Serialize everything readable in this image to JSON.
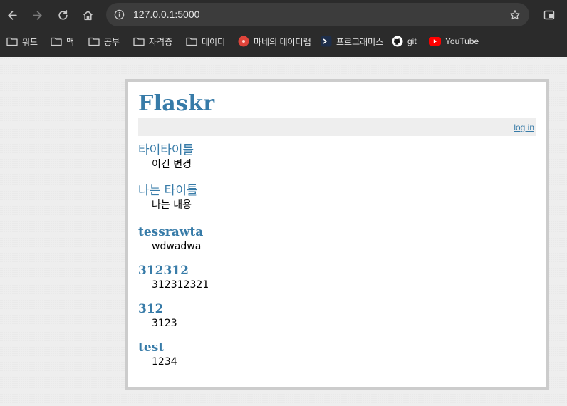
{
  "browser": {
    "url": "127.0.0.1:5000",
    "bookmarks": [
      {
        "label": "워드",
        "icon": "folder-icon"
      },
      {
        "label": "맥",
        "icon": "folder-icon"
      },
      {
        "label": "공부",
        "icon": "folder-icon"
      },
      {
        "label": "자격증",
        "icon": "folder-icon"
      },
      {
        "label": "데이터",
        "icon": "folder-icon"
      },
      {
        "label": "마네의 데이터랩",
        "icon": "site-icon"
      },
      {
        "label": "프로그래머스",
        "icon": "programmers-icon"
      },
      {
        "label": "git",
        "icon": "github-icon"
      },
      {
        "label": "YouTube",
        "icon": "youtube-icon"
      }
    ]
  },
  "app": {
    "title": "Flaskr",
    "nav": {
      "login_label": "log in"
    },
    "accent_color": "#377ba8",
    "posts": [
      {
        "title": "타이타이틀",
        "body": "이건 변경"
      },
      {
        "title": "나는 타이틀",
        "body": "나는 내용"
      },
      {
        "title": "tessrawta",
        "body": "wdwadwa"
      },
      {
        "title": "312312",
        "body": "312312321"
      },
      {
        "title": "312",
        "body": "3123"
      },
      {
        "title": "test",
        "body": "1234"
      }
    ]
  }
}
